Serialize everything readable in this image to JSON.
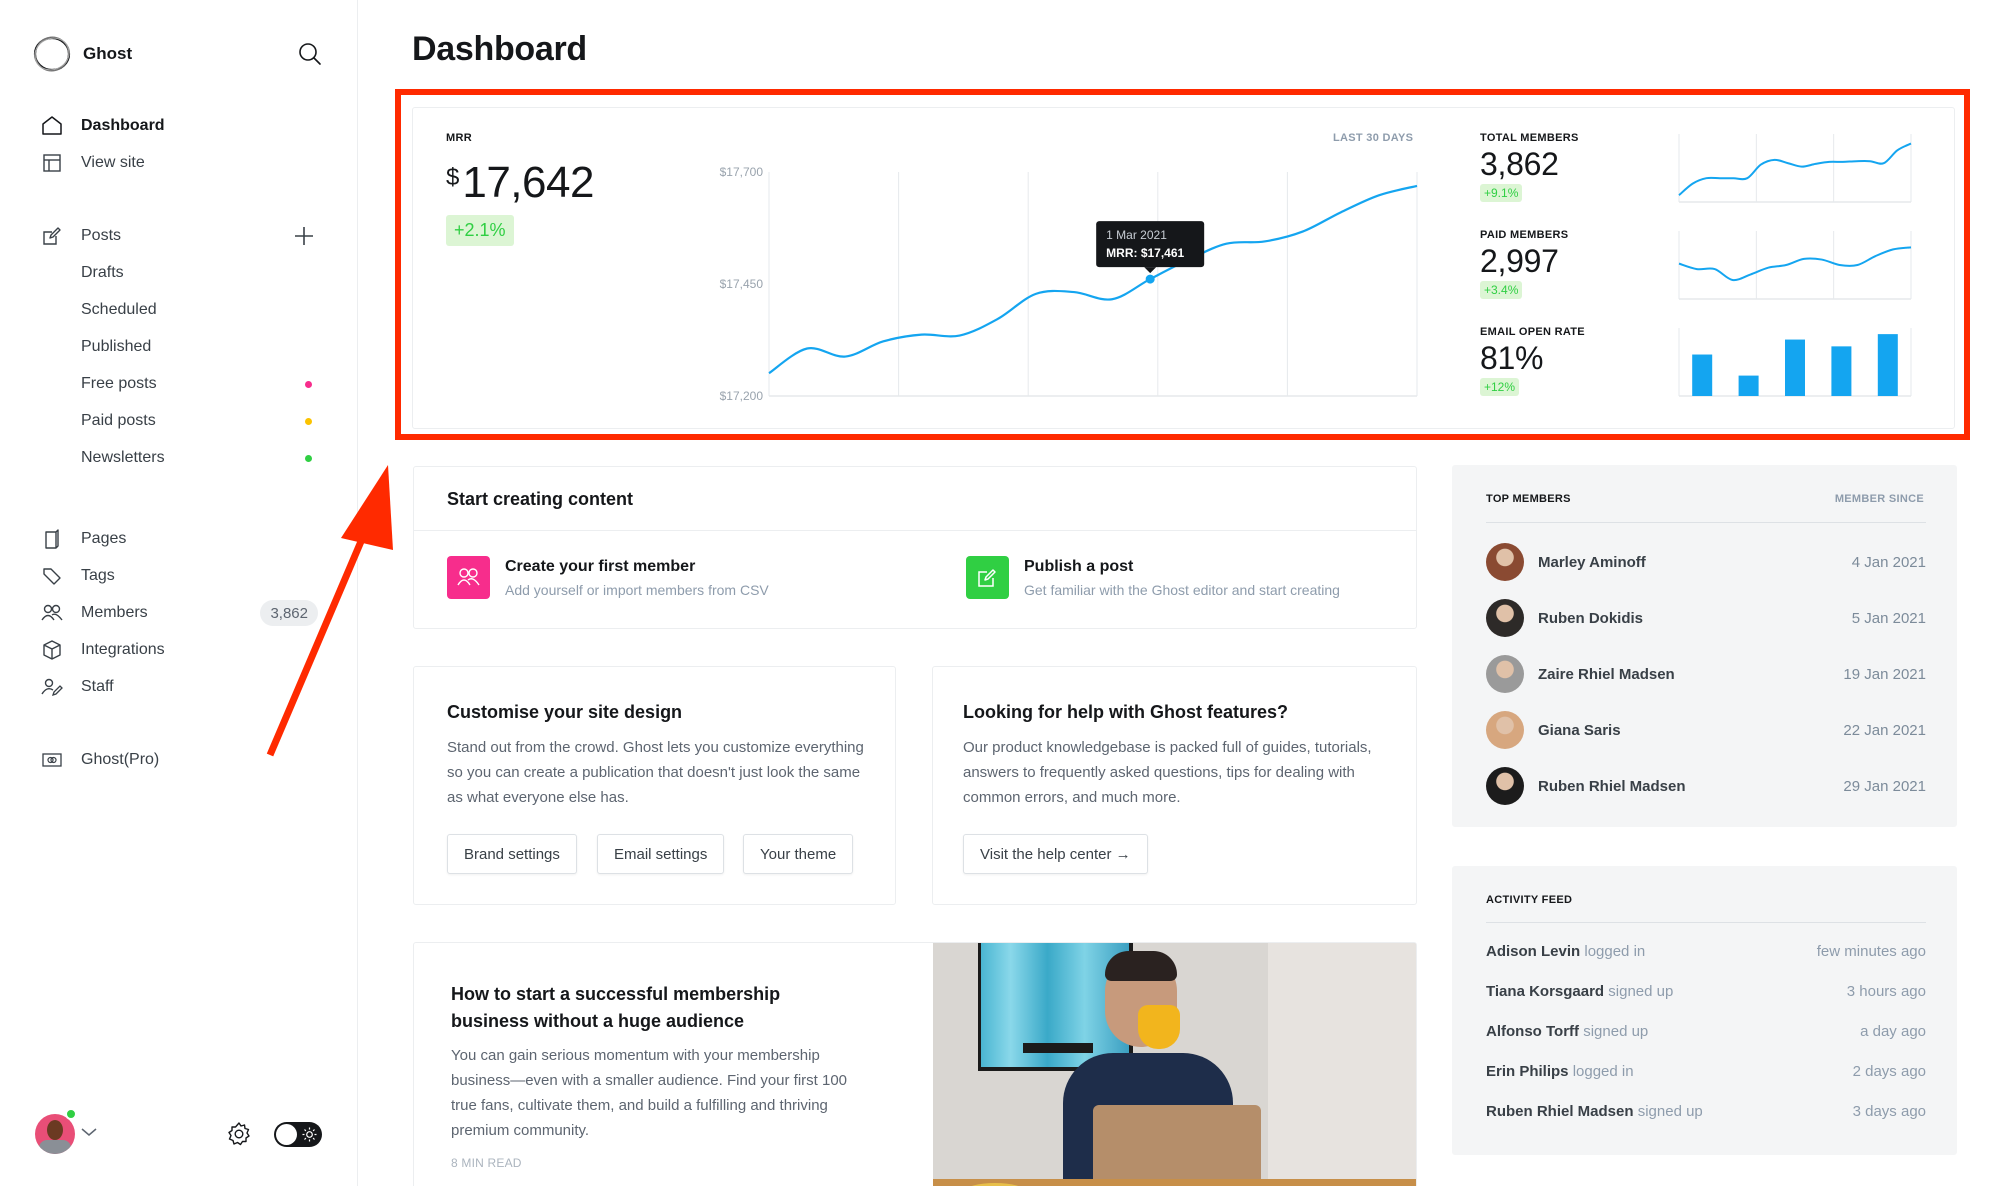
{
  "sidebar": {
    "brand": "Ghost",
    "nav": [
      {
        "label": "Dashboard",
        "icon": "home-icon",
        "active": true
      },
      {
        "label": "View site",
        "icon": "layout-icon"
      }
    ],
    "posts": {
      "label": "Posts",
      "sub": [
        {
          "label": "Drafts"
        },
        {
          "label": "Scheduled"
        },
        {
          "label": "Published"
        },
        {
          "label": "Free posts",
          "dot": "#f72d8c"
        },
        {
          "label": "Paid posts",
          "dot": "#fbc300"
        },
        {
          "label": "Newsletters",
          "dot": "#30cf43"
        }
      ]
    },
    "manage": [
      {
        "label": "Pages",
        "icon": "page-icon"
      },
      {
        "label": "Tags",
        "icon": "tag-icon"
      },
      {
        "label": "Members",
        "icon": "members-icon",
        "count": "3,862"
      },
      {
        "label": "Integrations",
        "icon": "cube-icon"
      },
      {
        "label": "Staff",
        "icon": "staff-icon"
      }
    ],
    "pro": {
      "label": "Ghost(Pro)",
      "icon": "card-icon"
    }
  },
  "header": {
    "title": "Dashboard"
  },
  "mrr": {
    "label": "MRR",
    "currency": "$",
    "value": "17,642",
    "change": "+2.1%",
    "period": "LAST 30 DAYS",
    "tooltip": {
      "date": "1 Mar 2021",
      "value": "MRR: $17,461"
    }
  },
  "chart_data": [
    {
      "type": "line",
      "title": "MRR",
      "subtitle": "LAST 30 DAYS",
      "xlabel": "",
      "ylabel": "",
      "ylim": [
        17200,
        17700
      ],
      "yticks": [
        "$17,700",
        "$17,450",
        "$17,200"
      ],
      "ytick_values": [
        17700,
        17450,
        17200
      ],
      "grid": true,
      "x": [
        0,
        1,
        2,
        3,
        4,
        5,
        6,
        7,
        8,
        9,
        10,
        11,
        12,
        13,
        14,
        15,
        16,
        17
      ],
      "series": [
        {
          "name": "MRR",
          "values": [
            17251,
            17306,
            17288,
            17322,
            17337,
            17335,
            17372,
            17428,
            17432,
            17416,
            17461,
            17504,
            17540,
            17545,
            17567,
            17610,
            17648,
            17669
          ]
        }
      ],
      "highlight": {
        "index": 10,
        "label": "1 Mar 2021",
        "value": 17461
      },
      "color": "#14a5f0"
    },
    {
      "type": "line",
      "title": "Total members",
      "ylim": [
        0,
        1
      ],
      "grid": true,
      "series": [
        {
          "name": "Total members",
          "values": [
            0.1,
            0.27,
            0.35,
            0.35,
            0.35,
            0.35,
            0.55,
            0.62,
            0.57,
            0.52,
            0.56,
            0.59,
            0.59,
            0.6,
            0.6,
            0.57,
            0.76,
            0.86
          ]
        }
      ],
      "color": "#14a5f0"
    },
    {
      "type": "line",
      "title": "Paid members",
      "ylim": [
        0,
        1
      ],
      "grid": true,
      "series": [
        {
          "name": "Paid members",
          "values": [
            0.52,
            0.44,
            0.44,
            0.28,
            0.36,
            0.46,
            0.5,
            0.59,
            0.58,
            0.5,
            0.5,
            0.63,
            0.73,
            0.76
          ]
        }
      ],
      "color": "#14a5f0"
    },
    {
      "type": "bar",
      "title": "Email open rate",
      "categories": [
        "1",
        "2",
        "3",
        "4",
        "5"
      ],
      "values": [
        0.61,
        0.3,
        0.83,
        0.73,
        0.91
      ],
      "ylim": [
        0,
        1
      ],
      "color": "#14a5f0"
    }
  ],
  "stats": [
    {
      "label": "TOTAL MEMBERS",
      "value": "3,862",
      "change": "+9.1%"
    },
    {
      "label": "PAID MEMBERS",
      "value": "2,997",
      "change": "+3.4%"
    },
    {
      "label": "EMAIL OPEN RATE",
      "value": "81%",
      "change": "+12%"
    }
  ],
  "start": {
    "title": "Start creating content",
    "items": [
      {
        "title": "Create your first member",
        "desc": "Add yourself or import members from CSV",
        "color": "#f72d8c"
      },
      {
        "title": "Publish a post",
        "desc": "Get familiar with the Ghost editor and start creating",
        "color": "#30cf43"
      }
    ]
  },
  "customise": {
    "title": "Customise your site design",
    "body": "Stand out from the crowd. Ghost lets you customize everything so you can create a publication that doesn't just look the same as what everyone else has.",
    "buttons": [
      "Brand settings",
      "Email settings",
      "Your theme"
    ]
  },
  "help": {
    "title": "Looking for help with Ghost features?",
    "body": "Our product knowledgebase is packed full of guides, tutorials, answers to frequently asked questions, tips for dealing with common errors, and much more.",
    "button": "Visit the help center →"
  },
  "article": {
    "title": "How to start a successful membership business without a huge audience",
    "body": "You can gain serious momentum with your membership business—even with a smaller audience. Find your first 100 true fans, cultivate them, and build a fulfilling and thriving premium community.",
    "meta": "8 MIN READ"
  },
  "top_members": {
    "title": "TOP MEMBERS",
    "col": "MEMBER SINCE",
    "rows": [
      {
        "name": "Marley Aminoff",
        "since": "4 Jan 2021",
        "avatar": "#8a4a32"
      },
      {
        "name": "Ruben Dokidis",
        "since": "5 Jan 2021",
        "avatar": "#2d2a28"
      },
      {
        "name": "Zaire Rhiel Madsen",
        "since": "19 Jan 2021",
        "avatar": "#9a9a9a"
      },
      {
        "name": "Giana Saris",
        "since": "22 Jan 2021",
        "avatar": "#d7a77f"
      },
      {
        "name": "Ruben Rhiel Madsen",
        "since": "29 Jan 2021",
        "avatar": "#1c1c1c"
      }
    ]
  },
  "activity": {
    "title": "ACTIVITY FEED",
    "rows": [
      {
        "who": "Adison Levin",
        "action": "logged in",
        "when": "few minutes ago"
      },
      {
        "who": "Tiana Korsgaard",
        "action": "signed up",
        "when": "3 hours ago"
      },
      {
        "who": "Alfonso Torff",
        "action": "signed up",
        "when": "a day ago"
      },
      {
        "who": "Erin Philips",
        "action": "logged in",
        "when": "2 days ago"
      },
      {
        "who": "Ruben Rhiel Madsen",
        "action": "signed up",
        "when": "3 days ago"
      }
    ]
  }
}
